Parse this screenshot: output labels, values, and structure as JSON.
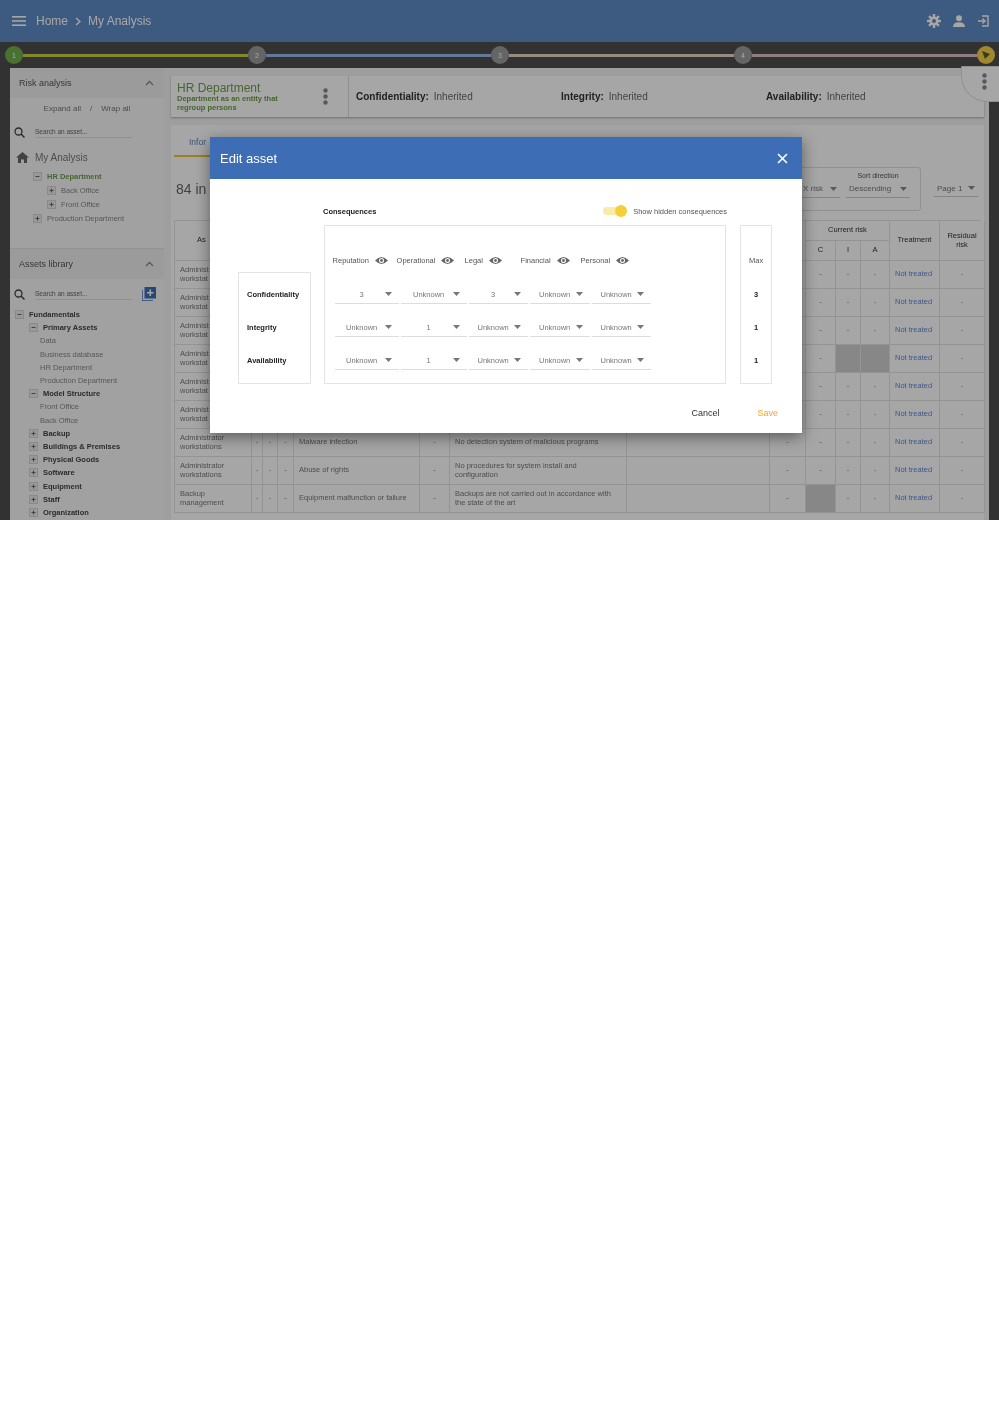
{
  "topbar": {
    "breadcrumb": [
      "Home",
      "My Analysis"
    ]
  },
  "stepper": {
    "steps": [
      {
        "label": "1",
        "done": true,
        "current": false
      },
      {
        "label": "2",
        "done": false,
        "current": false
      },
      {
        "label": "3",
        "done": false,
        "current": false
      },
      {
        "label": "4",
        "done": false,
        "current": false
      },
      {
        "done": false,
        "current": true
      }
    ]
  },
  "sidebar": {
    "risk_analysis": {
      "title": "Risk analysis",
      "expand_all": "Expand all",
      "separator": "/",
      "wrap_all": "Wrap all",
      "search": {
        "placeholder": "Search an asset..."
      },
      "root": "My Analysis",
      "tree": [
        {
          "label": "HR Department",
          "expanded": true,
          "selected": true,
          "children": [
            {
              "label": "Back Office",
              "expanded": false,
              "selected": false
            },
            {
              "label": "Front Office",
              "expanded": false,
              "selected": false
            }
          ]
        },
        {
          "label": "Production Department",
          "expanded": false,
          "selected": false
        }
      ]
    },
    "assets_library": {
      "title": "Assets library",
      "search": {
        "placeholder": "Search an asset..."
      },
      "tree": [
        {
          "label": "Fundamentals",
          "kind": "group",
          "expanded": true,
          "children": [
            {
              "label": "Primary Assets",
              "kind": "group",
              "expanded": true,
              "children": [
                {
                  "label": "Data",
                  "kind": "leaf"
                },
                {
                  "label": "Business database",
                  "kind": "leaf"
                },
                {
                  "label": "HR Department",
                  "kind": "leaf"
                },
                {
                  "label": "Production Department",
                  "kind": "leaf"
                }
              ]
            },
            {
              "label": "Model Structure",
              "kind": "group",
              "expanded": true,
              "children": [
                {
                  "label": "Front Office",
                  "kind": "leaf"
                },
                {
                  "label": "Back Office",
                  "kind": "leaf"
                }
              ]
            },
            {
              "label": "Backup",
              "kind": "group",
              "expanded": false
            },
            {
              "label": "Buildings & Premises",
              "kind": "group",
              "expanded": false
            },
            {
              "label": "Physical Goods",
              "kind": "group",
              "expanded": false
            },
            {
              "label": "Software",
              "kind": "group",
              "expanded": false
            },
            {
              "label": "Equipment",
              "kind": "group",
              "expanded": false
            },
            {
              "label": "Staff",
              "kind": "group",
              "expanded": false
            },
            {
              "label": "Organization",
              "kind": "group",
              "expanded": false
            }
          ]
        }
      ]
    }
  },
  "asset_header": {
    "name": "HR Department",
    "description": "Department as an entity that regroup persons",
    "criteria": [
      {
        "label": "Confidentiality:",
        "value": "Inherited"
      },
      {
        "label": "Integrity:",
        "value": "Inherited"
      },
      {
        "label": "Availability:",
        "value": "Inherited"
      }
    ]
  },
  "content": {
    "tab": {
      "label": "Infor",
      "selected": true
    },
    "count": "84 in",
    "sort_field": "X risk",
    "sort_direction": {
      "label": "Sort direction",
      "value": "Descending"
    },
    "page": "Page 1"
  },
  "table": {
    "headers": {
      "asset": "As",
      "current_risk": "Current risk",
      "risk_columns": [
        "C",
        "I",
        "A"
      ],
      "treatment": "Treatment",
      "residual_risk": "Residual risk"
    },
    "rows": [
      {
        "asset": "Administ\nworkstat",
        "current_risk": [
          {
            "value": "-",
            "shaded": false
          },
          {
            "value": "-",
            "shaded": false
          },
          {
            "value": "-",
            "shaded": false
          }
        ],
        "treatment": "Not treated",
        "residual_risk": "-"
      },
      {
        "asset": "Administ\nworkstat",
        "current_risk": [
          {
            "value": "-",
            "shaded": false
          },
          {
            "value": "-",
            "shaded": false
          },
          {
            "value": "-",
            "shaded": false
          }
        ],
        "treatment": "Not treated",
        "residual_risk": "-"
      },
      {
        "asset": "Administ\nworkstat",
        "current_risk": [
          {
            "value": "-",
            "shaded": false
          },
          {
            "value": "-",
            "shaded": false
          },
          {
            "value": "-",
            "shaded": false
          }
        ],
        "treatment": "Not treated",
        "residual_risk": "-"
      },
      {
        "asset": "Administ\nworkstat",
        "current_risk": [
          {
            "value": "-",
            "shaded": false
          },
          {
            "shaded": true
          },
          {
            "shaded": true
          }
        ],
        "treatment": "Not treated",
        "residual_risk": "-"
      },
      {
        "asset": "Administ\nworkstat",
        "current_risk": [
          {
            "value": "-",
            "shaded": false
          },
          {
            "value": "-",
            "shaded": false
          },
          {
            "value": "-",
            "shaded": false
          }
        ],
        "treatment": "Not treated",
        "residual_risk": "-"
      },
      {
        "asset": "Administ\nworkstat",
        "current_risk": [
          {
            "value": "-",
            "shaded": false
          },
          {
            "value": "-",
            "shaded": false
          },
          {
            "value": "-",
            "shaded": false
          }
        ],
        "treatment": "Not treated",
        "residual_risk": "-"
      },
      {
        "asset": "Administrator workstations",
        "column_2": "-",
        "column_3": "-",
        "column_4": "-",
        "column_5": "Malware infection",
        "column_6": "-",
        "column_7": "No detection system of malicious programs",
        "column_9": "-",
        "current_risk": [
          {
            "value": "-",
            "shaded": false
          },
          {
            "value": "-",
            "shaded": false
          },
          {
            "value": "-",
            "shaded": false
          }
        ],
        "treatment": "Not treated",
        "residual_risk": "-"
      },
      {
        "asset": "Administrator workstations",
        "column_2": "-",
        "column_3": "-",
        "column_4": "-",
        "column_5": "Abuse of rights",
        "column_6": "-",
        "column_7": "No procedures for system install and configuration",
        "column_9": "-",
        "current_risk": [
          {
            "value": "-",
            "shaded": false
          },
          {
            "value": "-",
            "shaded": false
          },
          {
            "value": "-",
            "shaded": false
          }
        ],
        "treatment": "Not treated",
        "residual_risk": "-"
      },
      {
        "asset": "Backup management",
        "column_2": "-",
        "column_3": "-",
        "column_4": "-",
        "column_5": "Equipment malfunction or failure",
        "column_6": "-",
        "column_7": "Backups are not carried out in accordance with the state of the art",
        "column_9": "-",
        "current_risk": [
          {
            "shaded": true
          },
          {
            "value": "-",
            "shaded": false
          },
          {
            "value": "-",
            "shaded": false
          }
        ],
        "treatment": "Not treated",
        "residual_risk": "-"
      }
    ]
  },
  "modal": {
    "title": "Edit asset",
    "consequences_title": "Consequences",
    "show_hidden": {
      "label": "Show hidden consequences",
      "on": true
    },
    "consequences": [
      "Reputation",
      "Operational",
      "Legal",
      "Financial",
      "Personal"
    ],
    "max_label": "Max",
    "rows": [
      {
        "label": "Confidentiality",
        "values": [
          "3",
          "Unknown",
          "3",
          "Unknown",
          "Unknown"
        ],
        "max": "3"
      },
      {
        "label": "Integrity",
        "values": [
          "Unknown",
          "1",
          "Unknown",
          "Unknown",
          "Unknown"
        ],
        "max": "1"
      },
      {
        "label": "Availability",
        "values": [
          "Unknown",
          "1",
          "Unknown",
          "Unknown",
          "Unknown"
        ],
        "max": "1"
      }
    ],
    "cancel": "Cancel",
    "save": "Save"
  }
}
